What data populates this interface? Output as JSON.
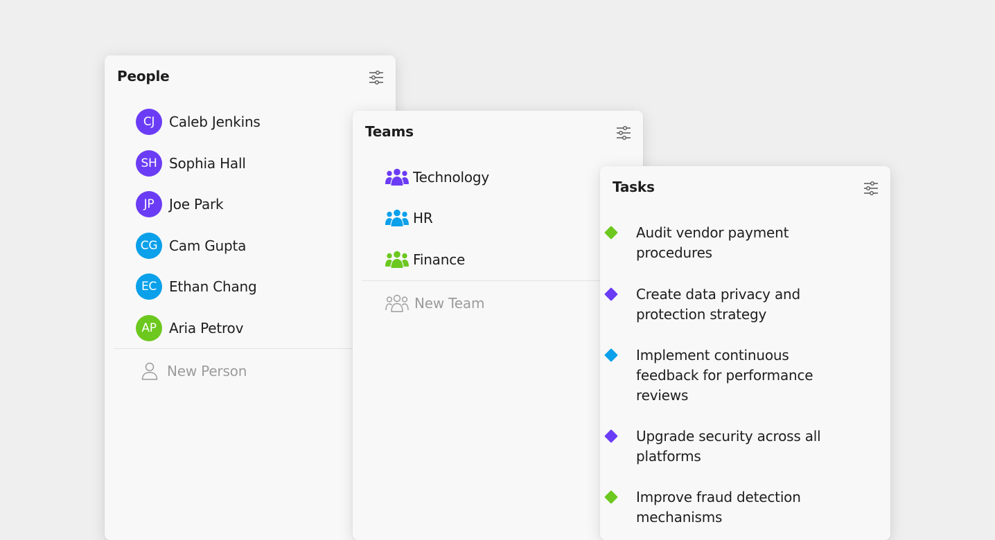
{
  "people_panel": {
    "title": "People",
    "filter_icon": "sliders-icon",
    "people": [
      {
        "initials": "CJ",
        "name": "Caleb Jenkins",
        "color": "#6b3cf5"
      },
      {
        "initials": "SH",
        "name": "Sophia Hall",
        "color": "#6b3cf5"
      },
      {
        "initials": "JP",
        "name": "Joe Park",
        "color": "#6b3cf5"
      },
      {
        "initials": "CG",
        "name": "Cam Gupta",
        "color": "#0aa0ea"
      },
      {
        "initials": "EC",
        "name": "Ethan Chang",
        "color": "#0aa0ea"
      },
      {
        "initials": "AP",
        "name": "Aria Petrov",
        "color": "#6cc81e"
      }
    ],
    "new_label": "New Person",
    "new_icon": "person-outline-icon"
  },
  "teams_panel": {
    "title": "Teams",
    "filter_icon": "sliders-icon",
    "teams": [
      {
        "name": "Technology",
        "color": "#6b3cf5",
        "icon": "team-icon"
      },
      {
        "name": "HR",
        "color": "#0aa0ea",
        "icon": "team-icon"
      },
      {
        "name": "Finance",
        "color": "#6cc81e",
        "icon": "team-icon"
      }
    ],
    "new_label": "New Team",
    "new_icon": "team-outline-icon"
  },
  "tasks_panel": {
    "title": "Tasks",
    "filter_icon": "sliders-icon",
    "tasks": [
      {
        "text": "Audit vendor payment procedures",
        "color": "#6cc81e"
      },
      {
        "text": "Create data privacy and protection strategy",
        "color": "#6b3cf5"
      },
      {
        "text": "Implement continuous feedback for performance reviews",
        "color": "#0aa0ea"
      },
      {
        "text": "Upgrade security across all platforms",
        "color": "#6b3cf5"
      },
      {
        "text": "Improve fraud detection mechanisms",
        "color": "#6cc81e"
      }
    ]
  }
}
